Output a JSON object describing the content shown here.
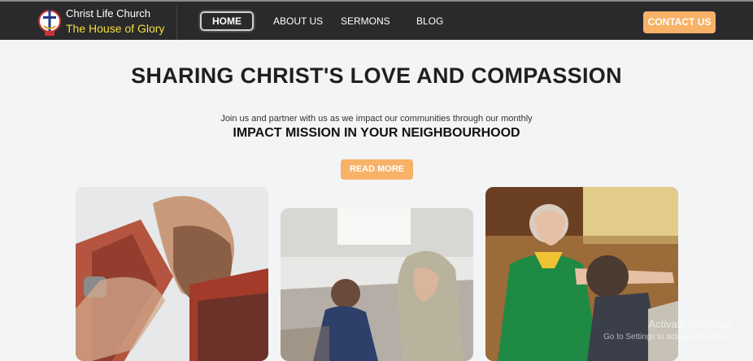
{
  "header": {
    "brand_line1": "Christ Life Church",
    "brand_line2": "The House of Glory",
    "nav": [
      "HOME",
      "ABOUT US",
      "SERMONS",
      "BLOG"
    ],
    "contact_label": "CONTACT US"
  },
  "hero": {
    "title": "SHARING CHRIST'S LOVE AND COMPASSION",
    "subtitle": "Join us and partner with us as we impact our communities through our monthly",
    "subtitle_strong": "IMPACT MISSION IN YOUR NEIGHBOURHOOD",
    "cta_label": "READ MORE"
  },
  "photos": [
    {
      "icon": "man-praying-photo"
    },
    {
      "icon": "people-praying-photo"
    },
    {
      "icon": "woman-blessing-photo"
    }
  ],
  "watermark": {
    "line1": "Activate Windows",
    "line2": "Go to Settings to activate Windows."
  },
  "colors": {
    "topbar": "#2a2a2c",
    "accent": "#f7b267",
    "brand_yellow": "#f4df3a",
    "page_bg": "#f3f4f6"
  }
}
